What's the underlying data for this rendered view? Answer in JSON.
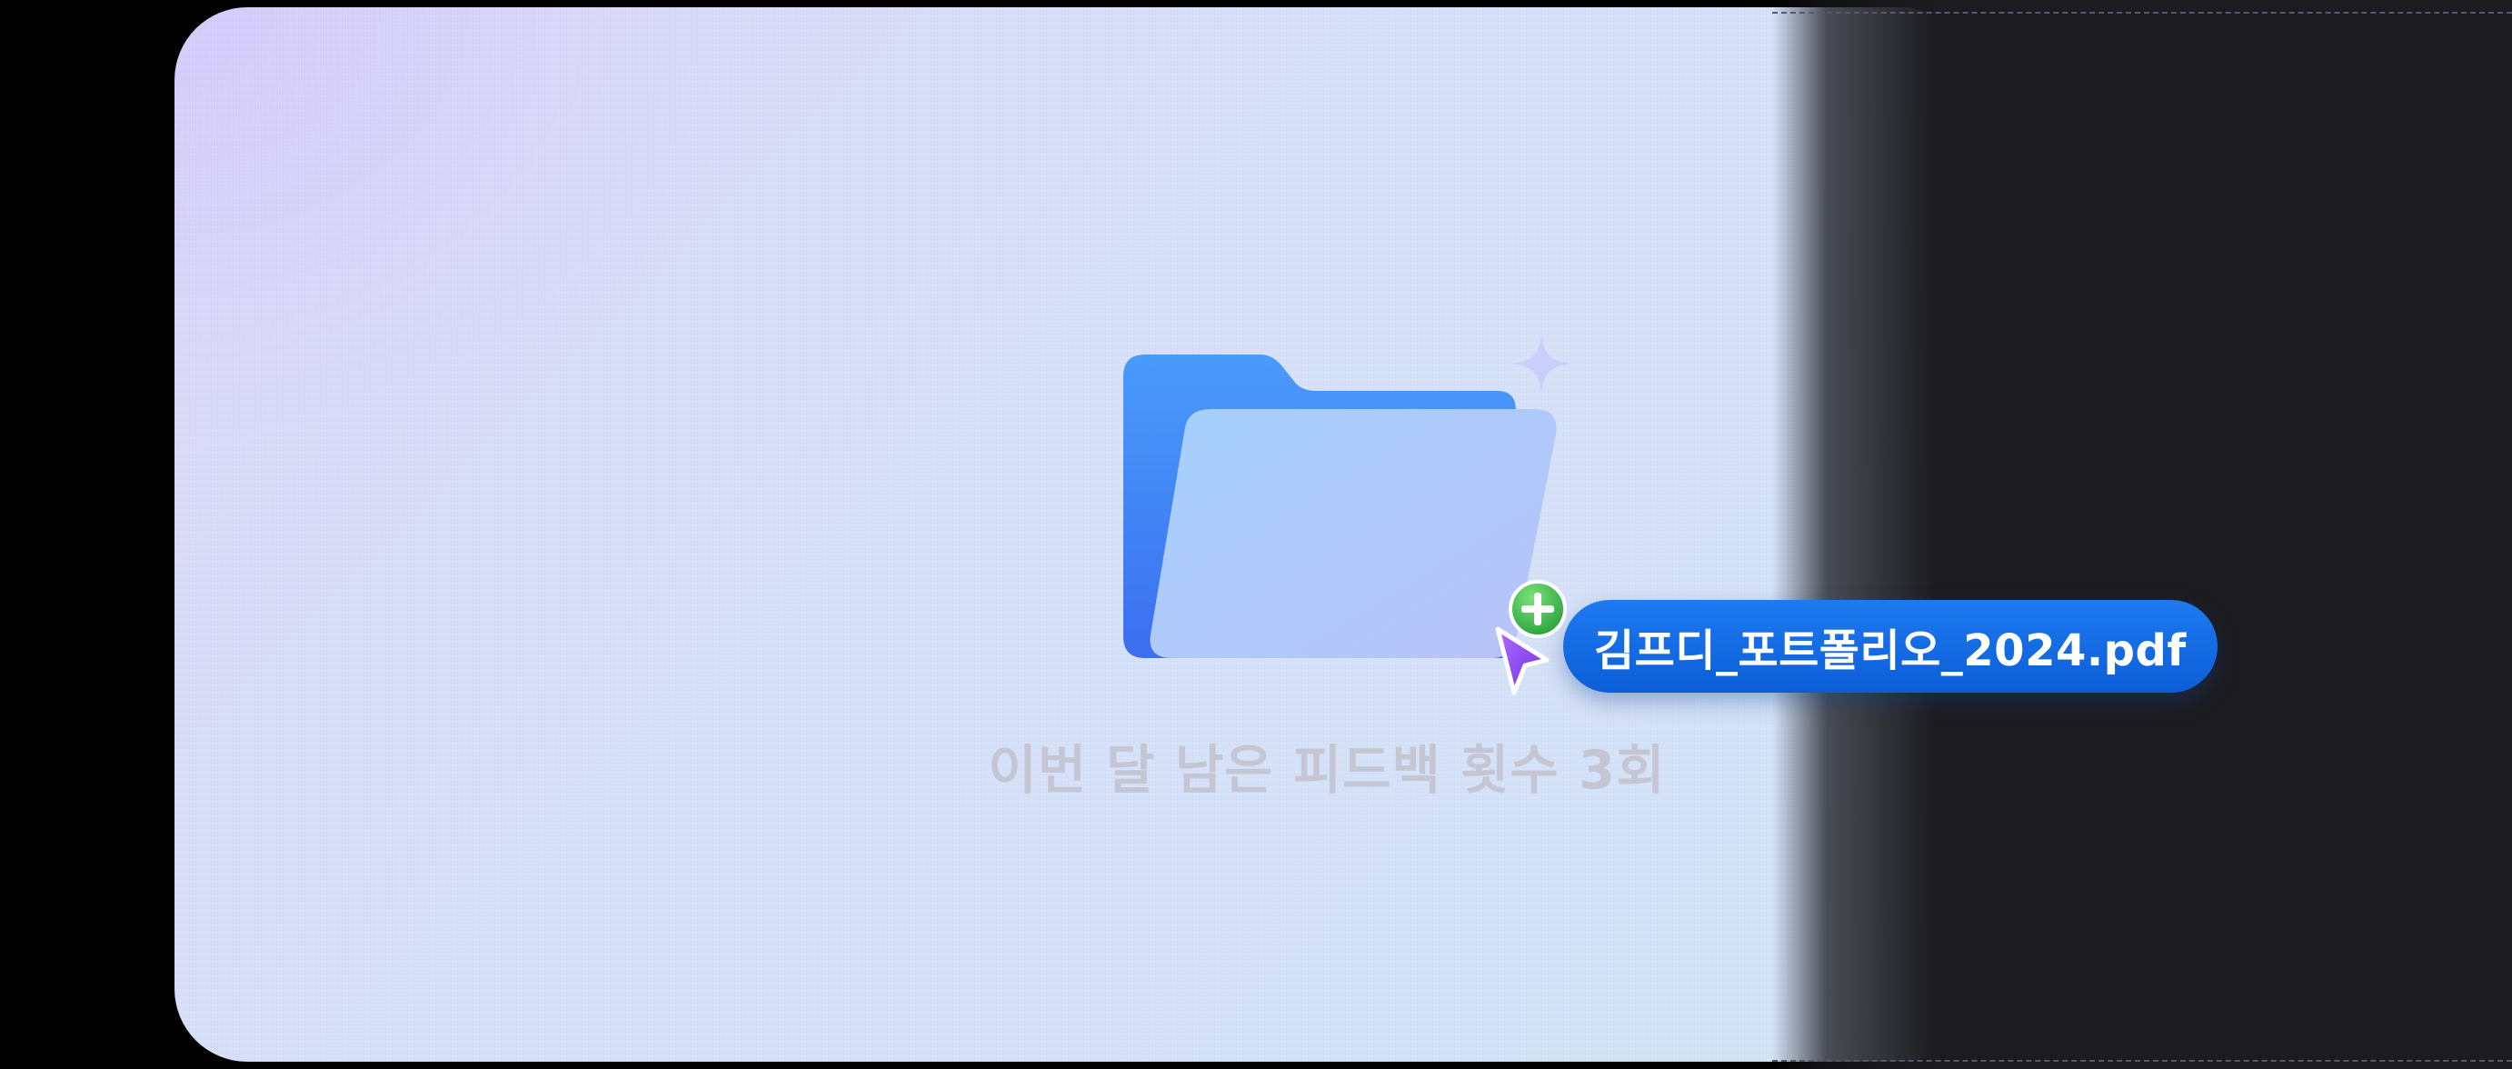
{
  "drop_zone": {
    "helper_text": "이번 달 남은 피드백 횟수 3회"
  },
  "dragged_file": {
    "name": "김프디_포트폴리오_2024.pdf",
    "chip_color": "#0b5ed7"
  },
  "icons": {
    "folder": "folder-icon",
    "sparkle": "sparkle-icon",
    "copy_badge": "plus-badge-icon",
    "pointer": "cursor-arrow-icon"
  },
  "colors": {
    "folder_back": "#3f8cf6",
    "folder_front": "#a7c4fb",
    "pointer": "#8a3cf0",
    "badge": "#28a745",
    "background_dark": "#1c1c20"
  }
}
